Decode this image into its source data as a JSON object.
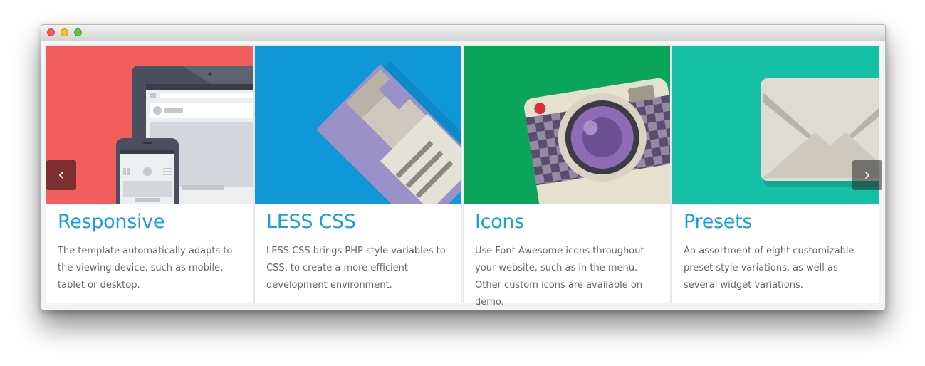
{
  "window": {
    "buttons": [
      "close",
      "minimize",
      "zoom"
    ]
  },
  "carousel": {
    "prev_label": "‹",
    "next_label": "›",
    "cards": [
      {
        "title": "Responsive",
        "text": "The template automatically adapts to the viewing device, such as mobile, tablet or desktop.",
        "bg": "#f25e5e",
        "icon": "devices-icon"
      },
      {
        "title": "LESS CSS",
        "text": "LESS CSS brings PHP style variables to CSS, to create a more efficient development environment.",
        "bg": "#0f97d8",
        "icon": "floppy-disk-icon"
      },
      {
        "title": "Icons",
        "text": "Use Font Awesome icons throughout your website, such as in the menu. Other custom icons are available on demo.",
        "bg": "#0aa55a",
        "icon": "camera-icon"
      },
      {
        "title": "Presets",
        "text": "An assortment of eight customizable preset style variations, as well as several widget variations.",
        "bg": "#16c0a6",
        "icon": "envelope-icon"
      }
    ]
  }
}
